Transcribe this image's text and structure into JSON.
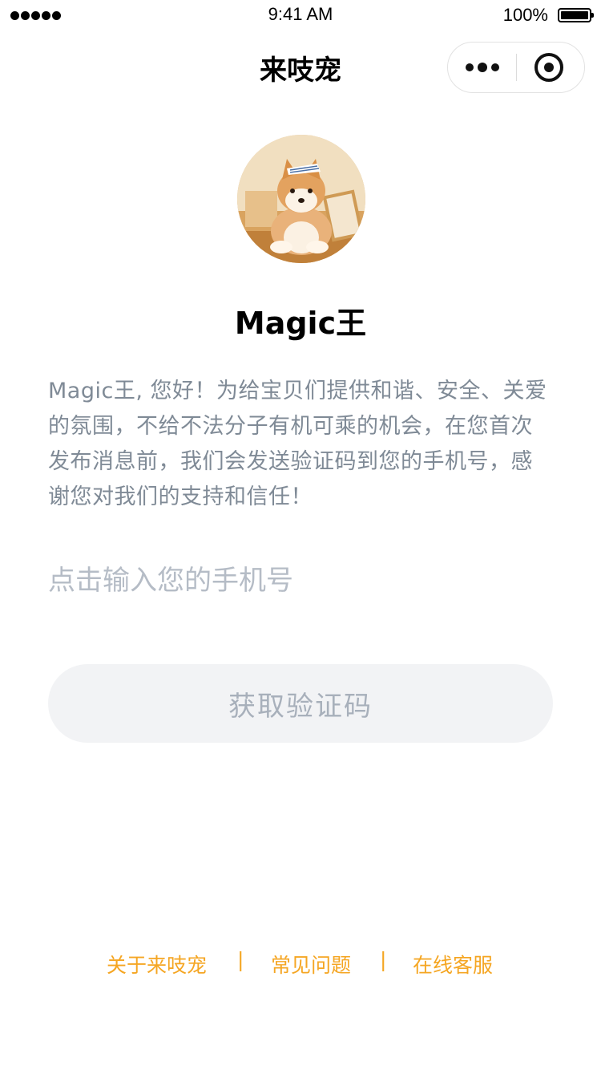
{
  "status_bar": {
    "time": "9:41 AM",
    "battery": "100%"
  },
  "nav": {
    "title": "来吱宠",
    "more_icon": "more-dots-icon",
    "close_icon": "target-close-icon"
  },
  "profile": {
    "avatar_icon": "shiba-avatar",
    "name": "Magic王"
  },
  "intro_text": "Magic王, 您好！为给宝贝们提供和谐、安全、关爱的氛围，不给不法分子有机可乘的机会，在您首次发布消息前，我们会发送验证码到您的手机号，感谢您对我们的支持和信任！",
  "phone": {
    "value": "",
    "placeholder": "点击输入您的手机号"
  },
  "get_code_button": "获取验证码",
  "footer": {
    "links": [
      "关于来吱宠",
      "常见问题",
      "在线客服"
    ],
    "separator": "|",
    "color": "#f5a623"
  }
}
